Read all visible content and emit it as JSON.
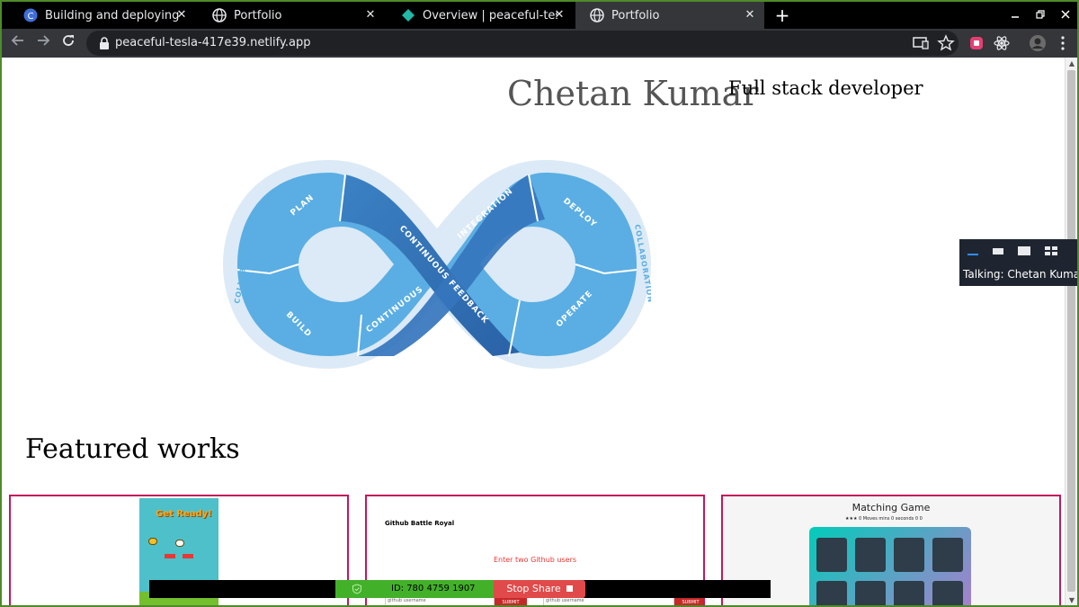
{
  "browser": {
    "tabs": [
      {
        "label": "Building and deploying fi",
        "icon": "c-logo-icon",
        "active": false
      },
      {
        "label": "Portfolio",
        "icon": "globe-icon",
        "active": false
      },
      {
        "label": "Overview | peaceful-tesla",
        "icon": "netlify-diamond-icon",
        "active": false
      },
      {
        "label": "Portfolio",
        "icon": "globe-icon",
        "active": true
      }
    ],
    "close_glyph": "✕",
    "new_tab_glyph": "+",
    "url": "peaceful-tesla-417e39.netlify.app",
    "colors": {
      "tab_active": "#35363a",
      "tabstrip": "#000000",
      "omnibox": "#202124"
    }
  },
  "page": {
    "name": "Chetan Kumar",
    "role": "Full stack developer",
    "devops": {
      "segments": [
        "PLAN",
        "BUILD",
        "CONTINUOUS",
        "CONTINUOUS FEEDBACK",
        "INTEGRATION",
        "DEPLOY",
        "OPERATE"
      ],
      "outer_left": "COLLABORATION",
      "outer_right": "COLLABORATION",
      "colors": {
        "light": "#5aaee3",
        "dark": "#2f6fb3",
        "ring": "#dbeaf6"
      }
    },
    "featured_heading": "Featured works",
    "works": [
      {
        "title": "Get Ready!"
      },
      {
        "title": "Github Battle Royal",
        "prompt": "Enter two Github users",
        "submit": "SUBMIT",
        "placeholder": "github username"
      },
      {
        "title": "Matching Game",
        "stars": "★★★  0 Moves  mins  0 seconds 0 0"
      }
    ],
    "card_border_color": "#c2185b"
  },
  "zoom": {
    "talking": "Talking: Chetan Kumar",
    "meeting_id": "ID: 780 4759 1907",
    "stop_share": "Stop Share",
    "colors": {
      "id_bg": "#43b02a",
      "stop_bg": "#e04a4a"
    }
  }
}
